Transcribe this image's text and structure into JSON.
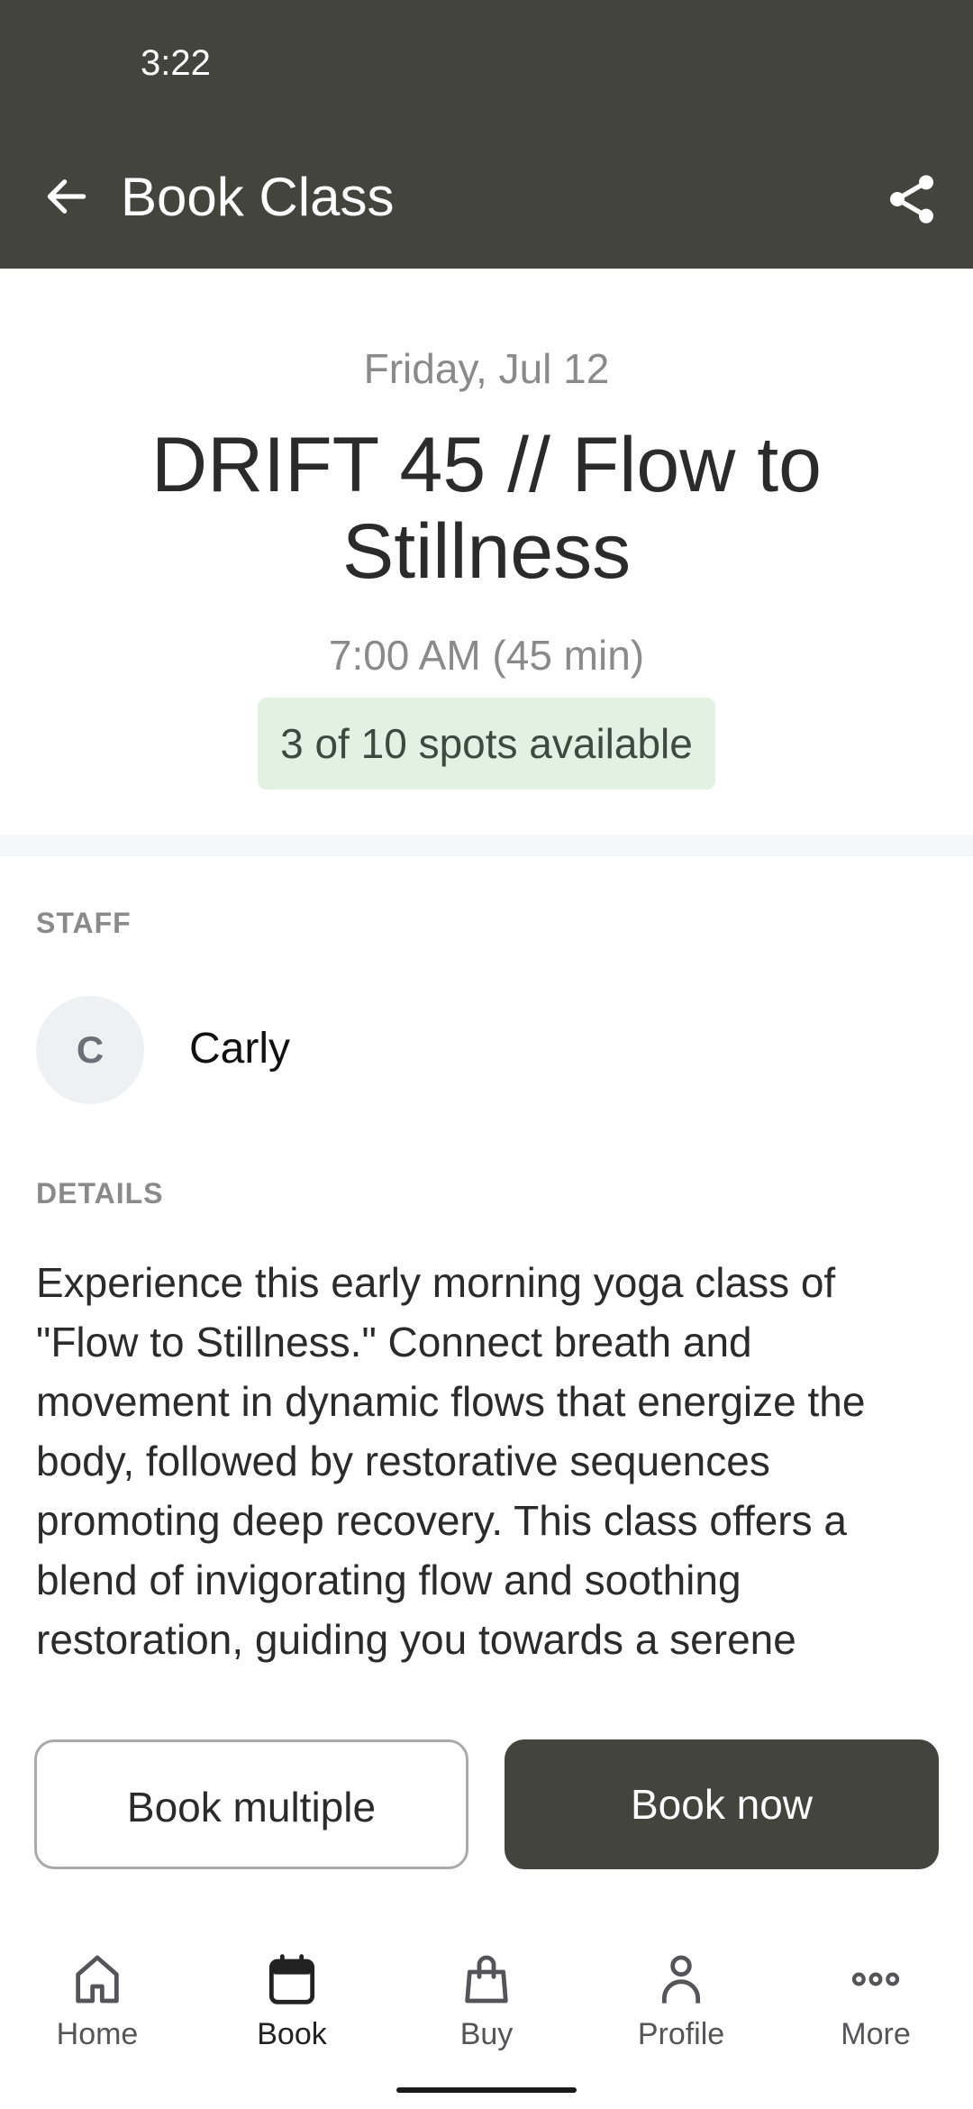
{
  "status_bar": {
    "time": "3:22"
  },
  "header": {
    "title": "Book Class",
    "back_icon": "arrow-left-icon",
    "share_icon": "share-icon"
  },
  "class": {
    "date": "Friday, Jul 12",
    "name": "DRIFT 45 // Flow to Stillness",
    "time": "7:00 AM (45 min)",
    "spots": "3 of 10 spots available"
  },
  "staff": {
    "label": "STAFF",
    "initial": "C",
    "name": "Carly"
  },
  "details": {
    "label": "DETAILS",
    "text": "Experience this early morning yoga class of \"Flow to Stillness.\" Connect breath and movement in dynamic flows that energize the body, followed by restorative sequences promoting deep recovery. This class offers a blend of invigorating flow and soothing restoration, guiding you towards a serene"
  },
  "actions": {
    "book_multiple": "Book multiple",
    "book_now": "Book now"
  },
  "nav": {
    "items": [
      {
        "label": "Home",
        "icon": "home-icon",
        "active": false
      },
      {
        "label": "Book",
        "icon": "calendar-icon",
        "active": true
      },
      {
        "label": "Buy",
        "icon": "shopping-bag-icon",
        "active": false
      },
      {
        "label": "Profile",
        "icon": "person-icon",
        "active": false
      },
      {
        "label": "More",
        "icon": "more-dots-icon",
        "active": false
      }
    ]
  },
  "colors": {
    "header_bg": "#44443e",
    "badge_bg": "#e3f1e3",
    "primary_button": "#44443e"
  }
}
